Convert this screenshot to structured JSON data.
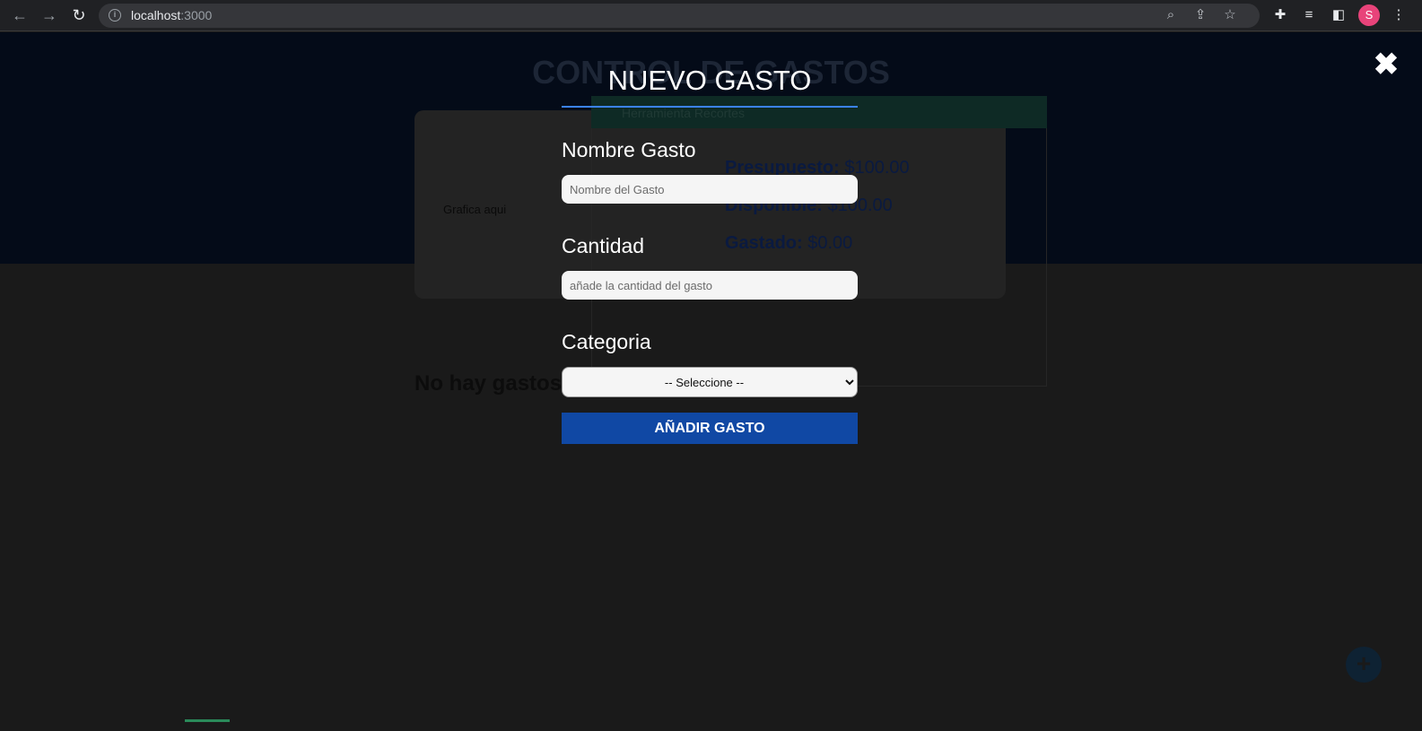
{
  "browser": {
    "url_host": "localhost",
    "url_port": ":3000",
    "profile_initial": "S"
  },
  "page": {
    "title": "CONTROL DE GASTOS",
    "chart_placeholder": "Grafica aqui",
    "notice": "Herramienta Recortes",
    "stats": [
      {
        "label": "Presupuesto:",
        "value": "$100.00"
      },
      {
        "label": "Disponible:",
        "value": "$100.00"
      },
      {
        "label": "Gastado:",
        "value": "$0.00"
      }
    ],
    "empty_list": "No hay gastos aún"
  },
  "modal": {
    "close_glyph": "✖",
    "title": "NUEVO GASTO",
    "name_label": "Nombre Gasto",
    "name_placeholder": "Nombre del Gasto",
    "amount_label": "Cantidad",
    "amount_placeholder": "añade la cantidad del gasto",
    "category_label": "Categoria",
    "category_selected": "-- Seleccione --",
    "submit_label": "AÑADIR GASTO"
  },
  "colors": {
    "accent": "#1048a4",
    "underline": "#3b82f6",
    "header_bg": "#040b18"
  }
}
